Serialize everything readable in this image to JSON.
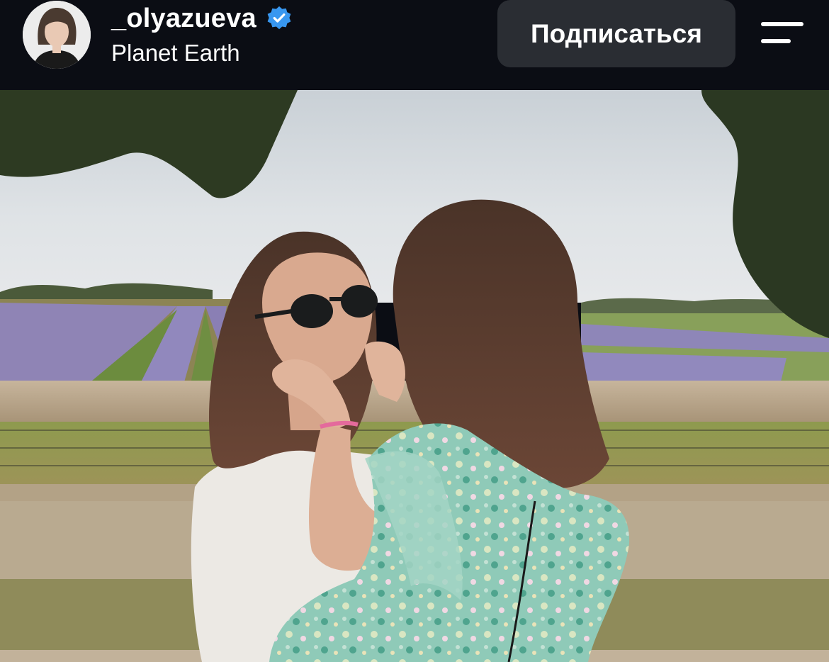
{
  "post_header": {
    "username": "_olyazueva",
    "verified": true,
    "location": "Planet Earth",
    "follow_label": "Подписаться",
    "avatar_icon": "profile-avatar",
    "verified_icon": "verified-badge-icon",
    "menu_icon": "hamburger-menu-icon"
  },
  "colors": {
    "background": "#0b0d14",
    "button_bg": "#2a2d33",
    "verified_blue": "#3897f0",
    "text": "#ffffff"
  },
  "post_image": {
    "icon": "photo"
  }
}
